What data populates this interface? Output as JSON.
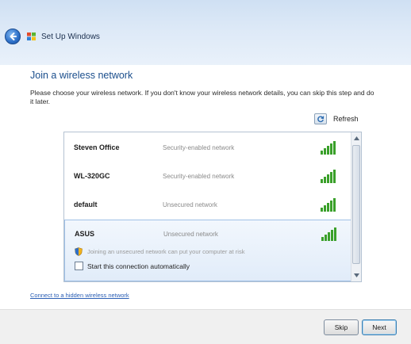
{
  "window": {
    "title": "Set Up Windows"
  },
  "page": {
    "heading": "Join a wireless network",
    "description": "Please choose your wireless network. If you don't know your wireless network details, you can skip this step and do it later."
  },
  "toolbar": {
    "refresh_label": "Refresh"
  },
  "networks": [
    {
      "name": "Steven Office",
      "security": "Security-enabled network"
    },
    {
      "name": "WL-320GC",
      "security": "Security-enabled network"
    },
    {
      "name": "default",
      "security": "Unsecured network"
    },
    {
      "name": "ASUS",
      "security": "Unsecured network",
      "selected": true,
      "warning": "Joining an unsecured network can put your computer at risk",
      "auto_connect_label": "Start this connection automatically"
    }
  ],
  "links": {
    "hidden_network": "Connect to a hidden wireless network"
  },
  "buttons": {
    "skip": "Skip",
    "next": "Next"
  },
  "colors": {
    "accent": "#1a4e8c",
    "signal": "#3aa02a"
  },
  "icons": {
    "back": "back-arrow-icon",
    "signal": "signal-strength-icon",
    "shield": "shield-warning-icon",
    "refresh": "refresh-icon"
  }
}
